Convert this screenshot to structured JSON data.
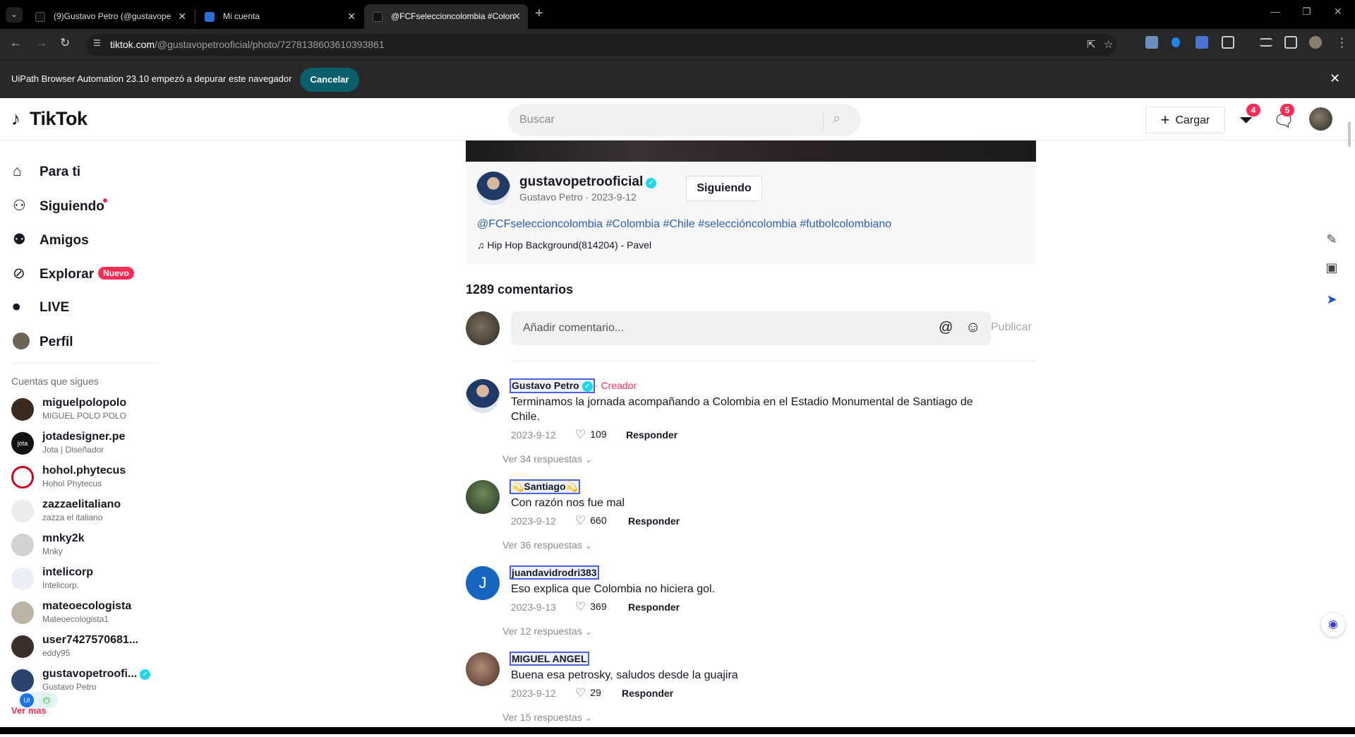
{
  "browser": {
    "tabs": [
      {
        "title": "(9)Gustavo Petro (@gustavope"
      },
      {
        "title": "Mi cuenta"
      },
      {
        "title": "@FCFseleccioncolombia #Colon"
      }
    ],
    "url_host": "tiktok.com",
    "url_path": "/@gustavopetrooficial/photo/7278138603610393861",
    "infobar_message": "UiPath Browser Automation 23.10 empezó a depurar este navegador",
    "infobar_cancel": "Cancelar"
  },
  "header": {
    "logo": "TikTok",
    "search_placeholder": "Buscar",
    "upload_label": "Cargar",
    "inbox_badge": "4",
    "messages_badge": "5"
  },
  "sidebar": {
    "nav": [
      {
        "label": "Para ti",
        "icon": "home-icon"
      },
      {
        "label": "Siguiendo",
        "icon": "following-icon"
      },
      {
        "label": "Amigos",
        "icon": "friends-icon"
      },
      {
        "label": "Explorar",
        "icon": "compass-icon",
        "badge": "Nuevo"
      },
      {
        "label": "LIVE",
        "icon": "live-icon"
      },
      {
        "label": "Perfil",
        "icon": "profile-avatar"
      }
    ],
    "following_title": "Cuentas que sigues",
    "accounts": [
      {
        "name": "miguelpolopolo",
        "sub": "MIGUEL POLO POLO",
        "color": "#3a2a22"
      },
      {
        "name": "jotadesigner.pe",
        "sub": "Jota | Diseñador",
        "color": "#111111"
      },
      {
        "name": "hohol.phytecus",
        "sub": "Hohol Phytecus",
        "color": "#d1001f"
      },
      {
        "name": "zazzaelitaliano",
        "sub": "zazza el italiano",
        "color": "#e7e7e7"
      },
      {
        "name": "mnky2k",
        "sub": "Mnky",
        "color": "#cfcfcf"
      },
      {
        "name": "intelicorp",
        "sub": "Intelicorp.",
        "color": "#e9eef7"
      },
      {
        "name": "mateoecologista",
        "sub": "Mateoecologista1",
        "color": "#bcb5a6"
      },
      {
        "name": "user7427570681...",
        "sub": "eddy95",
        "color": "#3b2f2a"
      },
      {
        "name": "gustavopetroofi...",
        "sub": "Gustavo Petro",
        "color": "#2a4470",
        "verified": true
      }
    ],
    "see_more": "Ver más"
  },
  "post": {
    "username": "gustavopetrooficial",
    "subline": "Gustavo Petro · 2023-9-12",
    "following_button": "Siguiendo",
    "hashtags": "@FCFseleccioncolombia #Colombia #Chile #seleccióncolombia #futbolcolombiano",
    "music": "Hip Hop Background(814204) - Pavel",
    "comments_count": "1289 comentarios",
    "comment_placeholder": "Añadir comentario...",
    "publish_label": "Publicar"
  },
  "comments": [
    {
      "user": "Gustavo Petro",
      "verified": true,
      "creator_label": "· Creador",
      "text": "Terminamos la jornada acompañando a Colombia en el Estadio Monumental de Santiago de Chile.",
      "date": "2023-9-12",
      "likes": "109",
      "reply": "Responder",
      "more": "Ver 34 respuestas",
      "avatar_color": "#1f3a66"
    },
    {
      "user": "💫Santiago💫",
      "text": "Con razón nos fue mal",
      "date": "2023-9-12",
      "likes": "660",
      "reply": "Responder",
      "more": "Ver 36 respuestas",
      "avatar_color": "#3f5a3a"
    },
    {
      "user": "juandavidrodri383",
      "text": "Eso explica que Colombia no hiciera gol.",
      "date": "2023-9-13",
      "likes": "369",
      "reply": "Responder",
      "more": "Ver 12 respuestas",
      "avatar_letter": "J",
      "avatar_color": "#1565c0"
    },
    {
      "user": "MIGUEL ANGEL",
      "text": "Buena esa petrosky, saludos desde la guajira",
      "date": "2023-9-12",
      "likes": "29",
      "reply": "Responder",
      "more": "Ver 15 respuestas",
      "avatar_color": "#6b4a3a"
    }
  ]
}
